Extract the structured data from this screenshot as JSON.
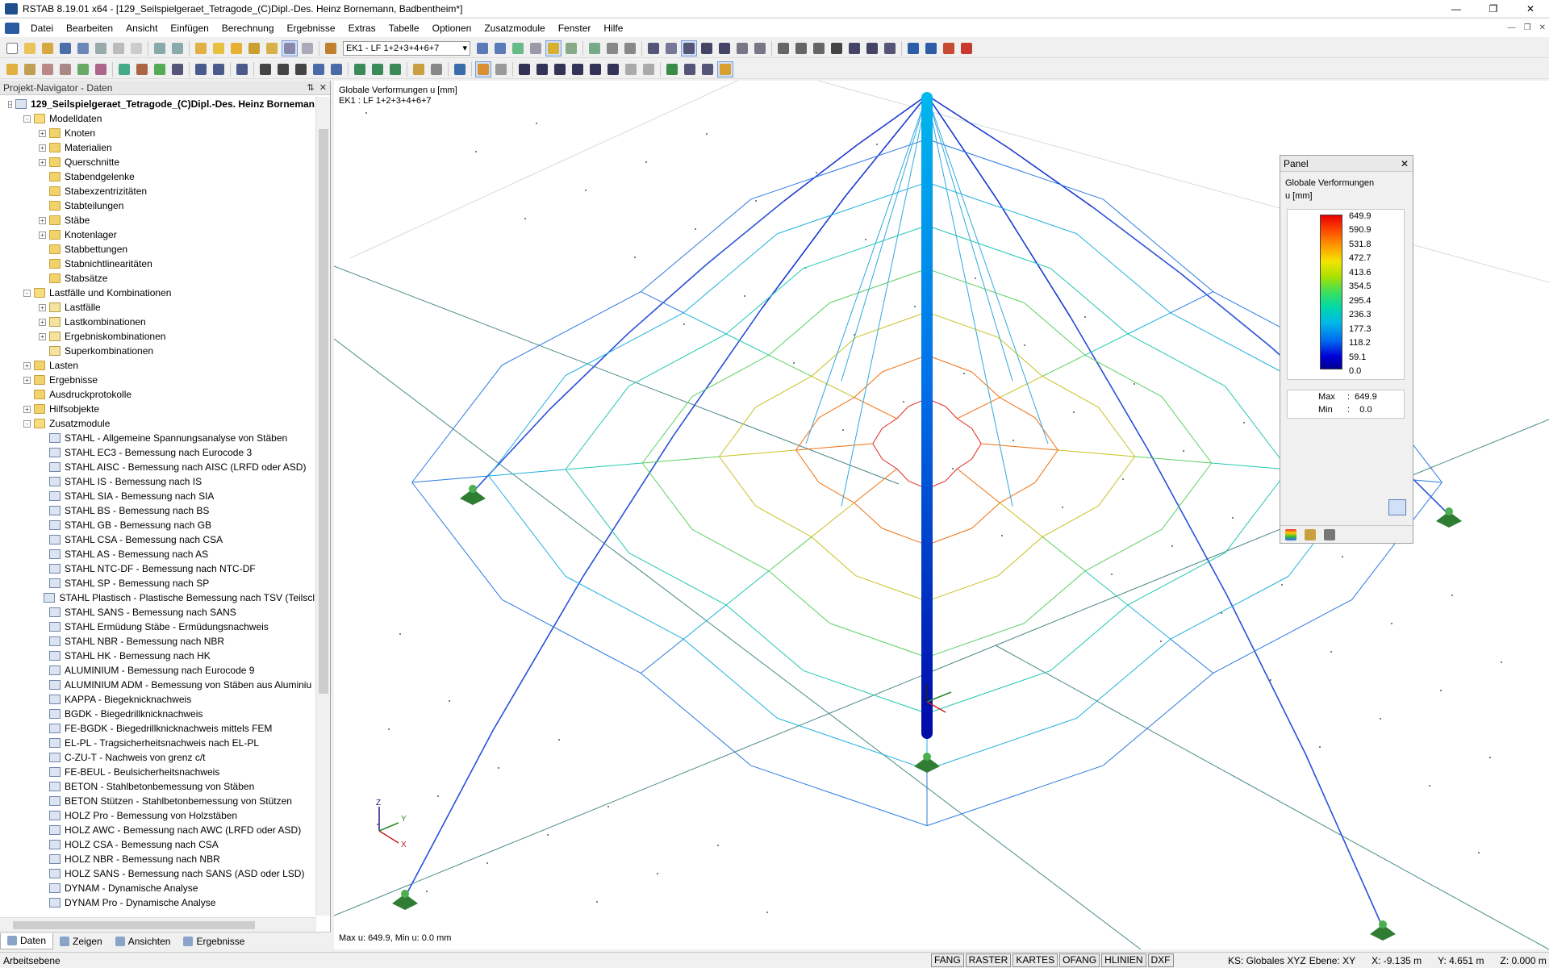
{
  "window": {
    "title": "RSTAB 8.19.01 x64 - [129_Seilspielgeraet_Tetragode_(C)Dipl.-Des. Heinz Bornemann, Badbentheim*]"
  },
  "menu": [
    "Datei",
    "Bearbeiten",
    "Ansicht",
    "Einfügen",
    "Berechnung",
    "Ergebnisse",
    "Extras",
    "Tabelle",
    "Optionen",
    "Zusatzmodule",
    "Fenster",
    "Hilfe"
  ],
  "toolbar": {
    "load_case": "EK1 - LF 1+2+3+4+6+7"
  },
  "navigator": {
    "title": "Projekt-Navigator - Daten",
    "root": "129_Seilspielgeraet_Tetragode_(C)Dipl.-Des. Heinz Borneman",
    "items": [
      {
        "label": "Modelldaten",
        "level": 1,
        "exp": "-",
        "icon": "folder-open"
      },
      {
        "label": "Knoten",
        "level": 2,
        "exp": "+",
        "icon": "folder"
      },
      {
        "label": "Materialien",
        "level": 2,
        "exp": "+",
        "icon": "folder"
      },
      {
        "label": "Querschnitte",
        "level": 2,
        "exp": "+",
        "icon": "folder"
      },
      {
        "label": "Stabendgelenke",
        "level": 2,
        "exp": "",
        "icon": "folder"
      },
      {
        "label": "Stabexzentrizitäten",
        "level": 2,
        "exp": "",
        "icon": "folder"
      },
      {
        "label": "Stabteilungen",
        "level": 2,
        "exp": "",
        "icon": "folder"
      },
      {
        "label": "Stäbe",
        "level": 2,
        "exp": "+",
        "icon": "folder"
      },
      {
        "label": "Knotenlager",
        "level": 2,
        "exp": "+",
        "icon": "folder"
      },
      {
        "label": "Stabbettungen",
        "level": 2,
        "exp": "",
        "icon": "folder"
      },
      {
        "label": "Stabnichtlinearitäten",
        "level": 2,
        "exp": "",
        "icon": "folder"
      },
      {
        "label": "Stabsätze",
        "level": 2,
        "exp": "",
        "icon": "folder"
      },
      {
        "label": "Lastfälle und Kombinationen",
        "level": 1,
        "exp": "-",
        "icon": "folder-open"
      },
      {
        "label": "Lastfälle",
        "level": 2,
        "exp": "+",
        "icon": "item"
      },
      {
        "label": "Lastkombinationen",
        "level": 2,
        "exp": "+",
        "icon": "item"
      },
      {
        "label": "Ergebniskombinationen",
        "level": 2,
        "exp": "+",
        "icon": "item"
      },
      {
        "label": "Superkombinationen",
        "level": 2,
        "exp": "",
        "icon": "item"
      },
      {
        "label": "Lasten",
        "level": 1,
        "exp": "+",
        "icon": "folder"
      },
      {
        "label": "Ergebnisse",
        "level": 1,
        "exp": "+",
        "icon": "folder"
      },
      {
        "label": "Ausdruckprotokolle",
        "level": 1,
        "exp": "",
        "icon": "folder"
      },
      {
        "label": "Hilfsobjekte",
        "level": 1,
        "exp": "+",
        "icon": "folder"
      },
      {
        "label": "Zusatzmodule",
        "level": 1,
        "exp": "-",
        "icon": "folder-open"
      },
      {
        "label": "STAHL - Allgemeine Spannungsanalyse von Stäben",
        "level": 2,
        "exp": "",
        "icon": "module"
      },
      {
        "label": "STAHL EC3 - Bemessung nach Eurocode 3",
        "level": 2,
        "exp": "",
        "icon": "module"
      },
      {
        "label": "STAHL AISC - Bemessung nach AISC (LRFD oder ASD)",
        "level": 2,
        "exp": "",
        "icon": "module"
      },
      {
        "label": "STAHL IS - Bemessung nach IS",
        "level": 2,
        "exp": "",
        "icon": "module"
      },
      {
        "label": "STAHL SIA - Bemessung nach SIA",
        "level": 2,
        "exp": "",
        "icon": "module"
      },
      {
        "label": "STAHL BS - Bemessung nach BS",
        "level": 2,
        "exp": "",
        "icon": "module"
      },
      {
        "label": "STAHL GB - Bemessung nach GB",
        "level": 2,
        "exp": "",
        "icon": "module"
      },
      {
        "label": "STAHL CSA - Bemessung nach CSA",
        "level": 2,
        "exp": "",
        "icon": "module"
      },
      {
        "label": "STAHL AS - Bemessung nach AS",
        "level": 2,
        "exp": "",
        "icon": "module"
      },
      {
        "label": "STAHL NTC-DF - Bemessung nach NTC-DF",
        "level": 2,
        "exp": "",
        "icon": "module"
      },
      {
        "label": "STAHL SP - Bemessung nach SP",
        "level": 2,
        "exp": "",
        "icon": "module"
      },
      {
        "label": "STAHL Plastisch - Plastische Bemessung nach TSV (Teilscl",
        "level": 2,
        "exp": "",
        "icon": "module"
      },
      {
        "label": "STAHL SANS - Bemessung nach SANS",
        "level": 2,
        "exp": "",
        "icon": "module"
      },
      {
        "label": "STAHL Ermüdung Stäbe - Ermüdungsnachweis",
        "level": 2,
        "exp": "",
        "icon": "module"
      },
      {
        "label": "STAHL NBR - Bemessung nach NBR",
        "level": 2,
        "exp": "",
        "icon": "module"
      },
      {
        "label": "STAHL HK - Bemessung nach HK",
        "level": 2,
        "exp": "",
        "icon": "module"
      },
      {
        "label": "ALUMINIUM - Bemessung nach Eurocode 9",
        "level": 2,
        "exp": "",
        "icon": "module"
      },
      {
        "label": "ALUMINIUM ADM - Bemessung von Stäben aus Aluminiu",
        "level": 2,
        "exp": "",
        "icon": "module"
      },
      {
        "label": "KAPPA - Biegeknicknachweis",
        "level": 2,
        "exp": "",
        "icon": "module"
      },
      {
        "label": "BGDK - Biegedrillknicknachweis",
        "level": 2,
        "exp": "",
        "icon": "module"
      },
      {
        "label": "FE-BGDK - Biegedrillknicknachweis mittels FEM",
        "level": 2,
        "exp": "",
        "icon": "module"
      },
      {
        "label": "EL-PL - Tragsicherheitsnachweis nach EL-PL",
        "level": 2,
        "exp": "",
        "icon": "module"
      },
      {
        "label": "C-ZU-T - Nachweis von grenz c/t",
        "level": 2,
        "exp": "",
        "icon": "module"
      },
      {
        "label": "FE-BEUL - Beulsicherheitsnachweis",
        "level": 2,
        "exp": "",
        "icon": "module"
      },
      {
        "label": "BETON - Stahlbetonbemessung von Stäben",
        "level": 2,
        "exp": "",
        "icon": "module"
      },
      {
        "label": "BETON Stützen - Stahlbetonbemessung von Stützen",
        "level": 2,
        "exp": "",
        "icon": "module"
      },
      {
        "label": "HOLZ Pro - Bemessung von Holzstäben",
        "level": 2,
        "exp": "",
        "icon": "module"
      },
      {
        "label": "HOLZ AWC - Bemessung nach AWC (LRFD oder ASD)",
        "level": 2,
        "exp": "",
        "icon": "module"
      },
      {
        "label": "HOLZ CSA - Bemessung nach CSA",
        "level": 2,
        "exp": "",
        "icon": "module"
      },
      {
        "label": "HOLZ NBR - Bemessung nach NBR",
        "level": 2,
        "exp": "",
        "icon": "module"
      },
      {
        "label": "HOLZ SANS - Bemessung nach SANS (ASD oder LSD)",
        "level": 2,
        "exp": "",
        "icon": "module"
      },
      {
        "label": "DYNAM - Dynamische Analyse",
        "level": 2,
        "exp": "",
        "icon": "module"
      },
      {
        "label": "DYNAM Pro - Dynamische Analyse",
        "level": 2,
        "exp": "",
        "icon": "module"
      }
    ],
    "tabs": [
      "Daten",
      "Zeigen",
      "Ansichten",
      "Ergebnisse"
    ]
  },
  "viewport": {
    "info_line1": "Globale Verformungen u [mm]",
    "info_line2": "EK1 : LF 1+2+3+4+6+7",
    "footer": "Max u: 649.9, Min u: 0.0 mm",
    "axis_x": "X",
    "axis_y": "Y",
    "axis_z": "Z"
  },
  "panel": {
    "title": "Panel",
    "heading1": "Globale Verformungen",
    "heading2": "u [mm]",
    "legend_values": [
      "649.9",
      "590.9",
      "531.8",
      "472.7",
      "413.6",
      "354.5",
      "295.4",
      "236.3",
      "177.3",
      "118.2",
      "59.1",
      "0.0"
    ],
    "max_label": "Max",
    "max_value": "649.9",
    "min_label": "Min",
    "min_value": "0.0",
    "colors": {
      "max": "#e80000",
      "min": "#000090"
    }
  },
  "statusbar": {
    "text": "Arbeitsebene",
    "toggles": [
      "FANG",
      "RASTER",
      "KARTES",
      "OFANG",
      "HLINIEN",
      "DXF"
    ],
    "cs": "KS: Globales XYZ",
    "plane": "Ebene: XY",
    "x": "X:  -9.135 m",
    "y": "Y:  4.651 m",
    "z": "Z:  0.000 m"
  }
}
